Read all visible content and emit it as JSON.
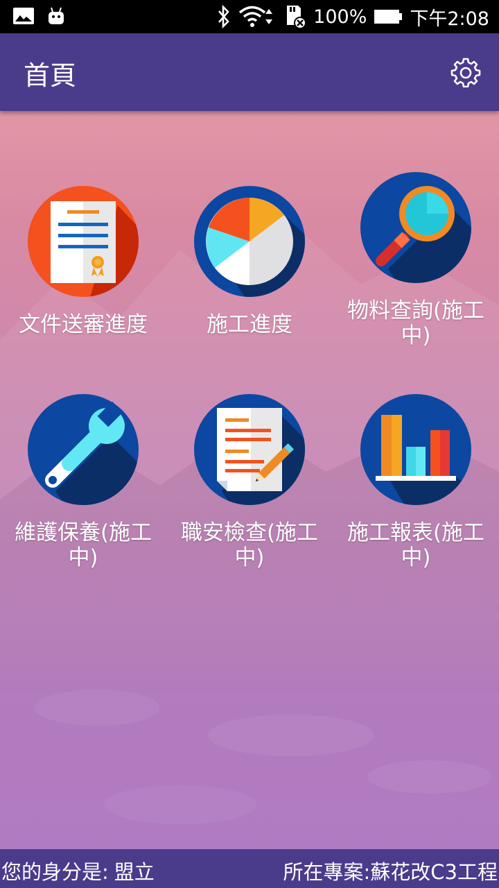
{
  "status_bar": {
    "battery": "100%",
    "time": "下午2:08",
    "icons": [
      "gallery-icon",
      "android-icon",
      "bluetooth-icon",
      "wifi-icon",
      "sd-card-error-icon",
      "battery-icon"
    ]
  },
  "app_bar": {
    "title": "首頁",
    "settings_icon": "gear-icon"
  },
  "menu": [
    {
      "label": "文件送審進度",
      "icon": "document-certificate-icon"
    },
    {
      "label": "施工進度",
      "icon": "pie-chart-icon"
    },
    {
      "label": "物料查詢(施工中)",
      "icon": "magnifier-icon"
    },
    {
      "label": "維護保養(施工中)",
      "icon": "wrench-icon"
    },
    {
      "label": "職安檢查(施工中)",
      "icon": "document-pencil-icon"
    },
    {
      "label": "施工報表(施工中)",
      "icon": "bar-chart-icon"
    }
  ],
  "footer": {
    "role_label": "您的身分是:",
    "role_value": "盟立",
    "project": "所在專案:蘇花改C3工程"
  },
  "colors": {
    "app_bar": "#4a3b8b",
    "icon_blue": "#0c47a1",
    "icon_orange": "#f4511e"
  }
}
